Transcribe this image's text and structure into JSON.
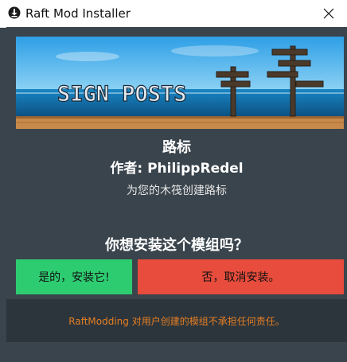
{
  "window": {
    "title": "Raft Mod Installer",
    "icon": "download-circle-icon"
  },
  "banner": {
    "text": "SIGN POSTS"
  },
  "mod": {
    "name": "路标",
    "author": "作者: PhilippRedel",
    "description": "为您的木筏创建路标"
  },
  "prompt": {
    "question": "你想安装这个模组吗？",
    "yes_label": "是的，安装它!",
    "no_label": "否，取消安装。"
  },
  "footer": {
    "disclaimer": "RaftModding 对用户创建的模组不承担任何责任。"
  },
  "colors": {
    "background": "#3a444c",
    "footer": "#2c353c",
    "yes": "#2ecc71",
    "no": "#e74c3c",
    "disclaimer": "#e67e22"
  }
}
